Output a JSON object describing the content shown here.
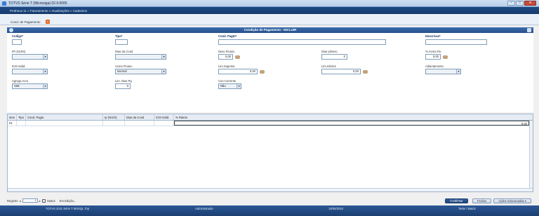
{
  "window": {
    "title": "TOTVS Série T (Microsiga) 02.9.0005"
  },
  "breadcrumb": "Protheus 11 » Faturamento » Atualizações » Cadastros",
  "tab": {
    "label": "Cond. de Pagamento",
    "close": "x"
  },
  "panel": {
    "title": "Condição de Pagamento - INCLUIR"
  },
  "form": {
    "codigo": {
      "label": "Codigo*",
      "value": ""
    },
    "tipo": {
      "label": "Tipo*",
      "value": ""
    },
    "cond_pagto": {
      "label": "Cond. Pagto*",
      "value": ""
    },
    "descricao": {
      "label": "Descricao*",
      "value": ""
    },
    "ipi": {
      "label": "IPI (N/J/S)",
      "value": ""
    },
    "dias_cond": {
      "label": "Dias da Cond",
      "value": ""
    },
    "desc_financ": {
      "label": "Desc.Financ.",
      "value": "0,00"
    },
    "dias_desc": {
      "label": "Dias p/Desc.",
      "value": "0"
    },
    "acres_fin_pct": {
      "label": "% Acres.Fin.",
      "value": "0,00"
    },
    "icm_solid": {
      "label": "ICM Solid.",
      "value": ""
    },
    "acres_financ": {
      "label": "Acres Financ.",
      "value": "Normal"
    },
    "lim_superior": {
      "label": "Lim.Superior",
      "value": "0,00"
    },
    "lim_inferior": {
      "label": "Lim.Inferior",
      "value": "0,00"
    },
    "adiantamento": {
      "label": "Adiantamento",
      "value": ""
    },
    "agrega_acre": {
      "label": "Agrega Acre.",
      "value": "SIM"
    },
    "lim_dias_pg": {
      "label": "Lim. Dias Pg",
      "value": "0"
    },
    "con_corrente": {
      "label": "Con.Corrente",
      "value": "Não"
    }
  },
  "grid": {
    "headers": [
      "Item",
      "Tipo",
      "Cond. Pagto",
      "Ip (N/J/S)",
      "Dias da Cond",
      "ICM Solid.",
      "% Rateio"
    ],
    "rows": [
      [
        "01",
        "",
        "",
        "",
        "",
        "",
        "0,00"
      ]
    ]
  },
  "footer": {
    "registro": "Registro",
    "page": "1",
    "status": "Status",
    "em_edicao": "Em Edição..."
  },
  "buttons": {
    "confirmar": "Confirmar",
    "fechar": "Fechar",
    "acoes": "Ações relacionadas"
  },
  "statusbar": {
    "version": "TOTVS 2011 Série T MSSQL Top",
    "user": "Administrador",
    "date": "19/05/2010",
    "env": "Teste / Matriz"
  }
}
